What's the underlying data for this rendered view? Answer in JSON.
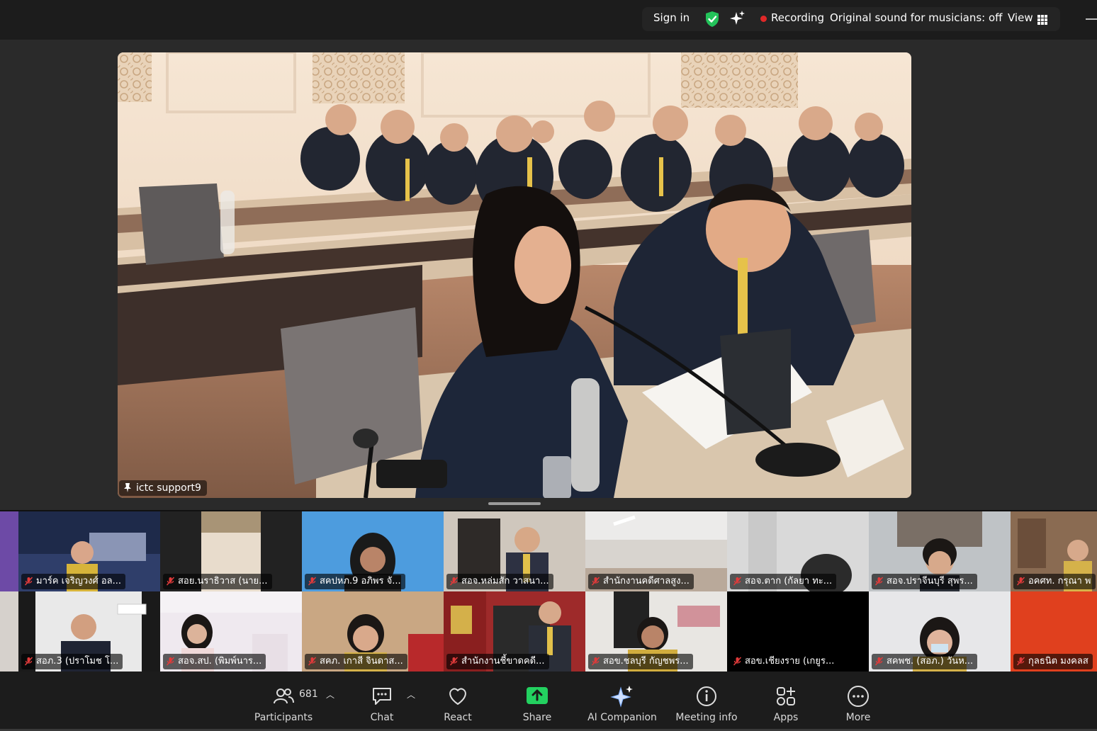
{
  "topbar": {
    "sign_in": "Sign in",
    "recording": "Recording",
    "original_sound": "Original sound for musicians: off",
    "view": "View"
  },
  "speaker": {
    "name": "ictc support9"
  },
  "gallery": {
    "row1": [
      {
        "name": "มาร์ค เจริญวงศ์ อล..."
      },
      {
        "name": "สอย.นราธิวาส (นาย..."
      },
      {
        "name": "สคปหภ.9 อภิพร จั..."
      },
      {
        "name": "สอจ.หล่มสัก วาสนา..."
      },
      {
        "name": "สำนักงานคดีศาลสูง..."
      },
      {
        "name": "สอจ.ตาก (กัลยา ทะ..."
      },
      {
        "name": "สอจ.ปราจีนบุรี สุพร..."
      },
      {
        "name": "อคศท. กรุณา พ"
      }
    ],
    "row2": [
      {
        "name": "สอภ.3  (ปราโมช โ..."
      },
      {
        "name": "สอจ.สป. (พิมพ์นาร..."
      },
      {
        "name": "สคภ. เกาสี จินดาส..."
      },
      {
        "name": "สำนักงานชี้ขาดคดี..."
      },
      {
        "name": "สอข.ชลบุรี กัญชพร..."
      },
      {
        "name": "สอข.เชียงราย (เกยูร..."
      },
      {
        "name": "สคพช. (สอภ.) วันห..."
      },
      {
        "name": "กุลธนิต มงคลส"
      }
    ]
  },
  "toolbar": {
    "participants": "Participants",
    "participants_count": "681",
    "chat": "Chat",
    "react": "React",
    "share": "Share",
    "ai_companion": "AI Companion",
    "meeting_info": "Meeting info",
    "apps": "Apps",
    "more": "More"
  },
  "colors": {
    "accent_green": "#23d160",
    "recording_red": "#e02828",
    "toolbar_bg": "#1c1c1c"
  }
}
